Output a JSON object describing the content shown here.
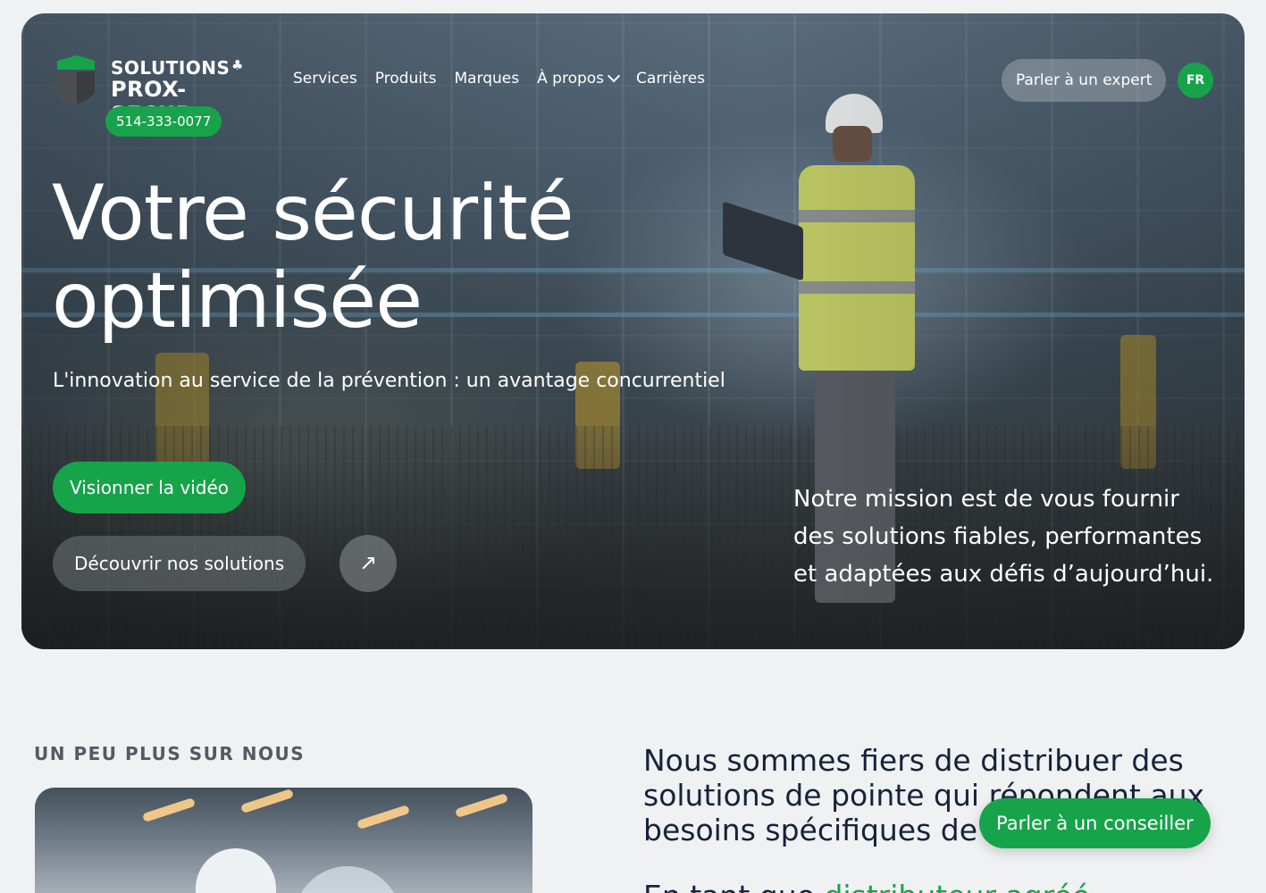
{
  "brand": {
    "line1": "SOLUTIONS",
    "line2": "PROX-SECUR",
    "phone": "514-333-0077",
    "colors": {
      "green": "#17a34a",
      "navy": "#15233a"
    }
  },
  "nav": {
    "items": [
      {
        "label": "Services"
      },
      {
        "label": "Produits"
      },
      {
        "label": "Marques"
      },
      {
        "label": "À propos",
        "has_dropdown": true
      },
      {
        "label": "Carrières"
      }
    ],
    "expert_button": "Parler à un expert",
    "language": "FR"
  },
  "hero": {
    "headline_line1": "Votre sécurité",
    "headline_line2": "optimisée",
    "subheading": "L'innovation au service de la prévention : un avantage concurrentiel",
    "video_button": "Visionner la vidéo",
    "solutions_button": "Découvrir nos solutions",
    "arrow_icon": "arrow-up-right-icon",
    "mission": "Notre mission est de vous fournir des solutions fiables, performantes et adaptées aux défis d’aujourd’hui."
  },
  "about": {
    "eyebrow": "UN PEU PLUS SUR NOUS",
    "statement": "Nous sommes fiers de distribuer des solutions de pointe qui répondent aux besoins spécifiques de",
    "partial_next_plain": "En tant que",
    "partial_next_green": "distributeur agréé",
    "float_button": "Parler à un conseiller"
  }
}
